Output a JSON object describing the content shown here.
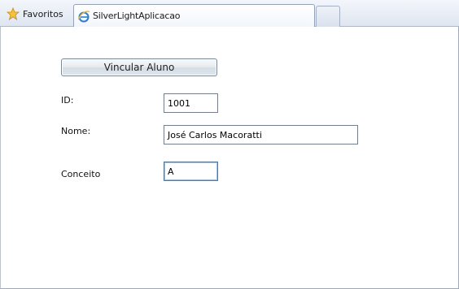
{
  "browser": {
    "favorites_label": "Favoritos",
    "tab_title": "SilverLightAplicacao"
  },
  "form": {
    "bind_button_label": "Vincular Aluno",
    "id_label": "ID:",
    "id_value": "1001",
    "name_label": "Nome:",
    "name_value": "José Carlos Macoratti",
    "grade_label": "Conceito",
    "grade_value": "A"
  },
  "colors": {
    "accent_border": "#4c79a8",
    "frame_border": "#9aa9bd"
  }
}
